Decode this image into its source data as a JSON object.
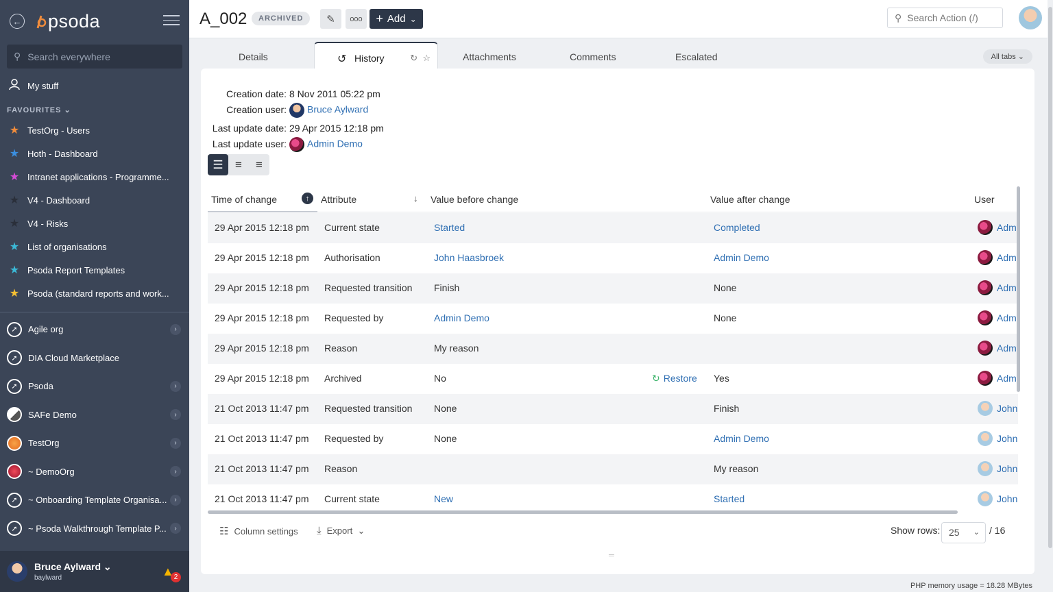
{
  "app": {
    "logo_text": "psoda"
  },
  "sidebar": {
    "search_placeholder": "Search everywhere",
    "my_stuff": "My stuff",
    "favourites_title": "FAVOURITES",
    "favourites": [
      {
        "label": "TestOrg - Users",
        "color": "#f08c3c"
      },
      {
        "label": "Hoth - Dashboard",
        "color": "#3b8fe0"
      },
      {
        "label": "Intranet applications - Programme...",
        "color": "#d54bd6"
      },
      {
        "label": "V4 - Dashboard",
        "color": "#2a2f3a"
      },
      {
        "label": "V4 - Risks",
        "color": "#2a2f3a"
      },
      {
        "label": "List of organisations",
        "color": "#3bb8d6"
      },
      {
        "label": "Psoda Report Templates",
        "color": "#3bb8d6"
      },
      {
        "label": "Psoda (standard reports and work...",
        "color": "#f5c033"
      }
    ],
    "orgs": [
      {
        "label": "Agile org",
        "chevron": true,
        "style": "compass"
      },
      {
        "label": "DIA Cloud Marketplace",
        "chevron": false,
        "style": "compass"
      },
      {
        "label": "Psoda",
        "chevron": true,
        "style": "compass"
      },
      {
        "label": "SAFe Demo",
        "chevron": true,
        "style": "half"
      },
      {
        "label": "TestOrg",
        "chevron": true,
        "style": "orange"
      },
      {
        "label": "~ DemoOrg",
        "chevron": true,
        "style": "red"
      },
      {
        "label": "~ Onboarding Template Organisa...",
        "chevron": true,
        "style": "compass"
      },
      {
        "label": "~ Psoda Walkthrough Template P...",
        "chevron": true,
        "style": "compass"
      }
    ],
    "user_name": "Bruce Aylward",
    "user_login": "baylward",
    "notification_count": "2"
  },
  "header": {
    "title": "A_002",
    "status_badge": "ARCHIVED",
    "more_label": "ooo",
    "add_label": "Add",
    "search_placeholder": "Search Action (/)"
  },
  "tabs": {
    "items": [
      "Details",
      "History",
      "Attachments",
      "Comments",
      "Escalated"
    ],
    "active": "History",
    "all_tabs": "All tabs"
  },
  "meta": {
    "creation_date_label": "Creation date:",
    "creation_date": "8 Nov 2011 05:22 pm",
    "creation_user_label": "Creation user:",
    "creation_user": "Bruce Aylward",
    "last_update_date_label": "Last update date:",
    "last_update_date": "29 Apr 2015 12:18 pm",
    "last_update_user_label": "Last update user:",
    "last_update_user": "Admin Demo"
  },
  "table": {
    "columns": [
      "Time of change",
      "Attribute",
      "Value before change",
      "Value after change",
      "User"
    ],
    "restore_label": "Restore",
    "rows": [
      {
        "time": "29 Apr 2015 12:18 pm",
        "attribute": "Current state",
        "before": "Started",
        "before_link": true,
        "after": "Completed",
        "after_link": true,
        "user": "Adm",
        "avatar": "admin",
        "restore": false
      },
      {
        "time": "29 Apr 2015 12:18 pm",
        "attribute": "Authorisation",
        "before": "John Haasbroek",
        "before_link": true,
        "after": "Admin Demo",
        "after_link": true,
        "user": "Adm",
        "avatar": "admin",
        "restore": false
      },
      {
        "time": "29 Apr 2015 12:18 pm",
        "attribute": "Requested transition",
        "before": "Finish",
        "before_link": false,
        "after": "None",
        "after_link": false,
        "user": "Adm",
        "avatar": "admin",
        "restore": false
      },
      {
        "time": "29 Apr 2015 12:18 pm",
        "attribute": "Requested by",
        "before": "Admin Demo",
        "before_link": true,
        "after": "None",
        "after_link": false,
        "user": "Adm",
        "avatar": "admin",
        "restore": false
      },
      {
        "time": "29 Apr 2015 12:18 pm",
        "attribute": "Reason",
        "before": "My reason",
        "before_link": false,
        "after": "",
        "after_link": false,
        "user": "Adm",
        "avatar": "admin",
        "restore": false
      },
      {
        "time": "29 Apr 2015 12:18 pm",
        "attribute": "Archived",
        "before": "No",
        "before_link": false,
        "after": "Yes",
        "after_link": false,
        "user": "Adm",
        "avatar": "admin",
        "restore": true
      },
      {
        "time": "21 Oct 2013 11:47 pm",
        "attribute": "Requested transition",
        "before": "None",
        "before_link": false,
        "after": "Finish",
        "after_link": false,
        "user": "John",
        "avatar": "john",
        "restore": false
      },
      {
        "time": "21 Oct 2013 11:47 pm",
        "attribute": "Requested by",
        "before": "None",
        "before_link": false,
        "after": "Admin Demo",
        "after_link": true,
        "user": "John",
        "avatar": "john",
        "restore": false
      },
      {
        "time": "21 Oct 2013 11:47 pm",
        "attribute": "Reason",
        "before": "",
        "before_link": false,
        "after": "My reason",
        "after_link": false,
        "user": "John",
        "avatar": "john",
        "restore": false
      },
      {
        "time": "21 Oct 2013 11:47 pm",
        "attribute": "Current state",
        "before": "New",
        "before_link": true,
        "after": "Started",
        "after_link": true,
        "user": "John",
        "avatar": "john",
        "restore": false
      }
    ]
  },
  "footer": {
    "column_settings": "Column settings",
    "export": "Export",
    "show_rows_label": "Show rows:",
    "rows_value": "25",
    "total_pages": "/ 16",
    "memory": "PHP memory usage = 18.28 MBytes"
  }
}
